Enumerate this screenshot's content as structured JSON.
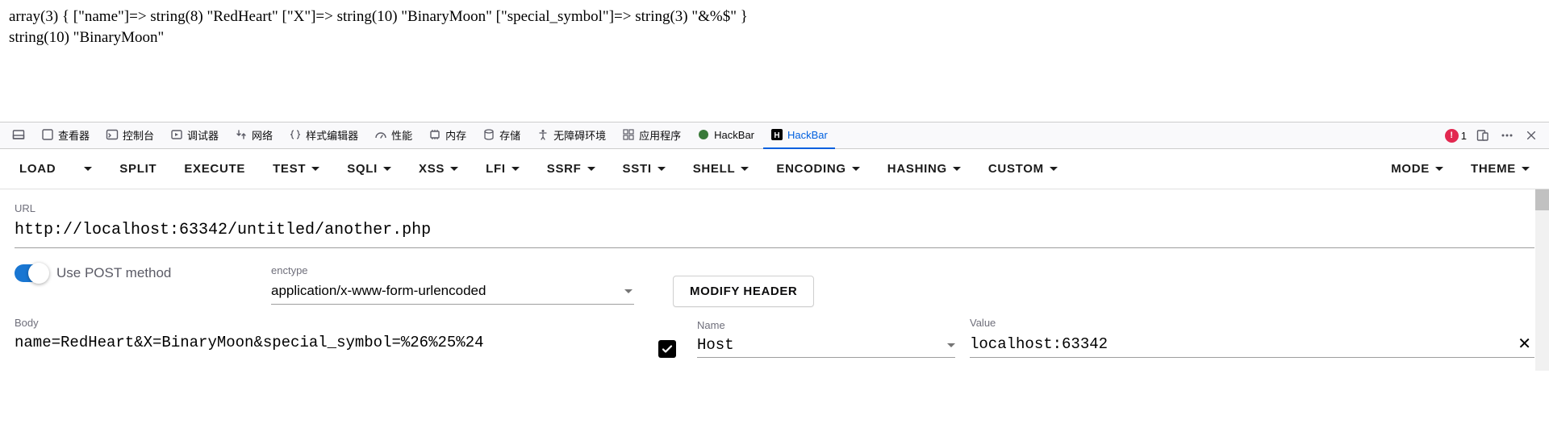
{
  "page_output": {
    "line1": "array(3) { [\"name\"]=> string(8) \"RedHeart\" [\"X\"]=> string(10) \"BinaryMoon\" [\"special_symbol\"]=> string(3) \"&%$\" }",
    "line2": "string(10) \"BinaryMoon\""
  },
  "devtools_tabs": {
    "inspector": "查看器",
    "console": "控制台",
    "debugger": "调试器",
    "network": "网络",
    "style_editor": "样式编辑器",
    "performance": "性能",
    "memory": "内存",
    "storage": "存储",
    "accessibility": "无障碍环境",
    "application": "应用程序",
    "hackbar1": "HackBar",
    "hackbar2": "HackBar"
  },
  "error_count": "1",
  "hackbar_toolbar": {
    "load": "LOAD",
    "split": "SPLIT",
    "execute": "EXECUTE",
    "test": "TEST",
    "sqli": "SQLI",
    "xss": "XSS",
    "lfi": "LFI",
    "ssrf": "SSRF",
    "ssti": "SSTI",
    "shell": "SHELL",
    "encoding": "ENCODING",
    "hashing": "HASHING",
    "custom": "CUSTOM",
    "mode": "MODE",
    "theme": "THEME"
  },
  "panel": {
    "url_label": "URL",
    "url_value": "http://localhost:63342/untitled/another.php",
    "use_post_label": "Use POST method",
    "enctype_label": "enctype",
    "enctype_value": "application/x-www-form-urlencoded",
    "modify_header": "MODIFY HEADER",
    "body_label": "Body",
    "body_value": "name=RedHeart&X=BinaryMoon&special_symbol=%26%25%24",
    "header_name_label": "Name",
    "header_name_value": "Host",
    "header_value_label": "Value",
    "header_value_value": "localhost:63342"
  }
}
